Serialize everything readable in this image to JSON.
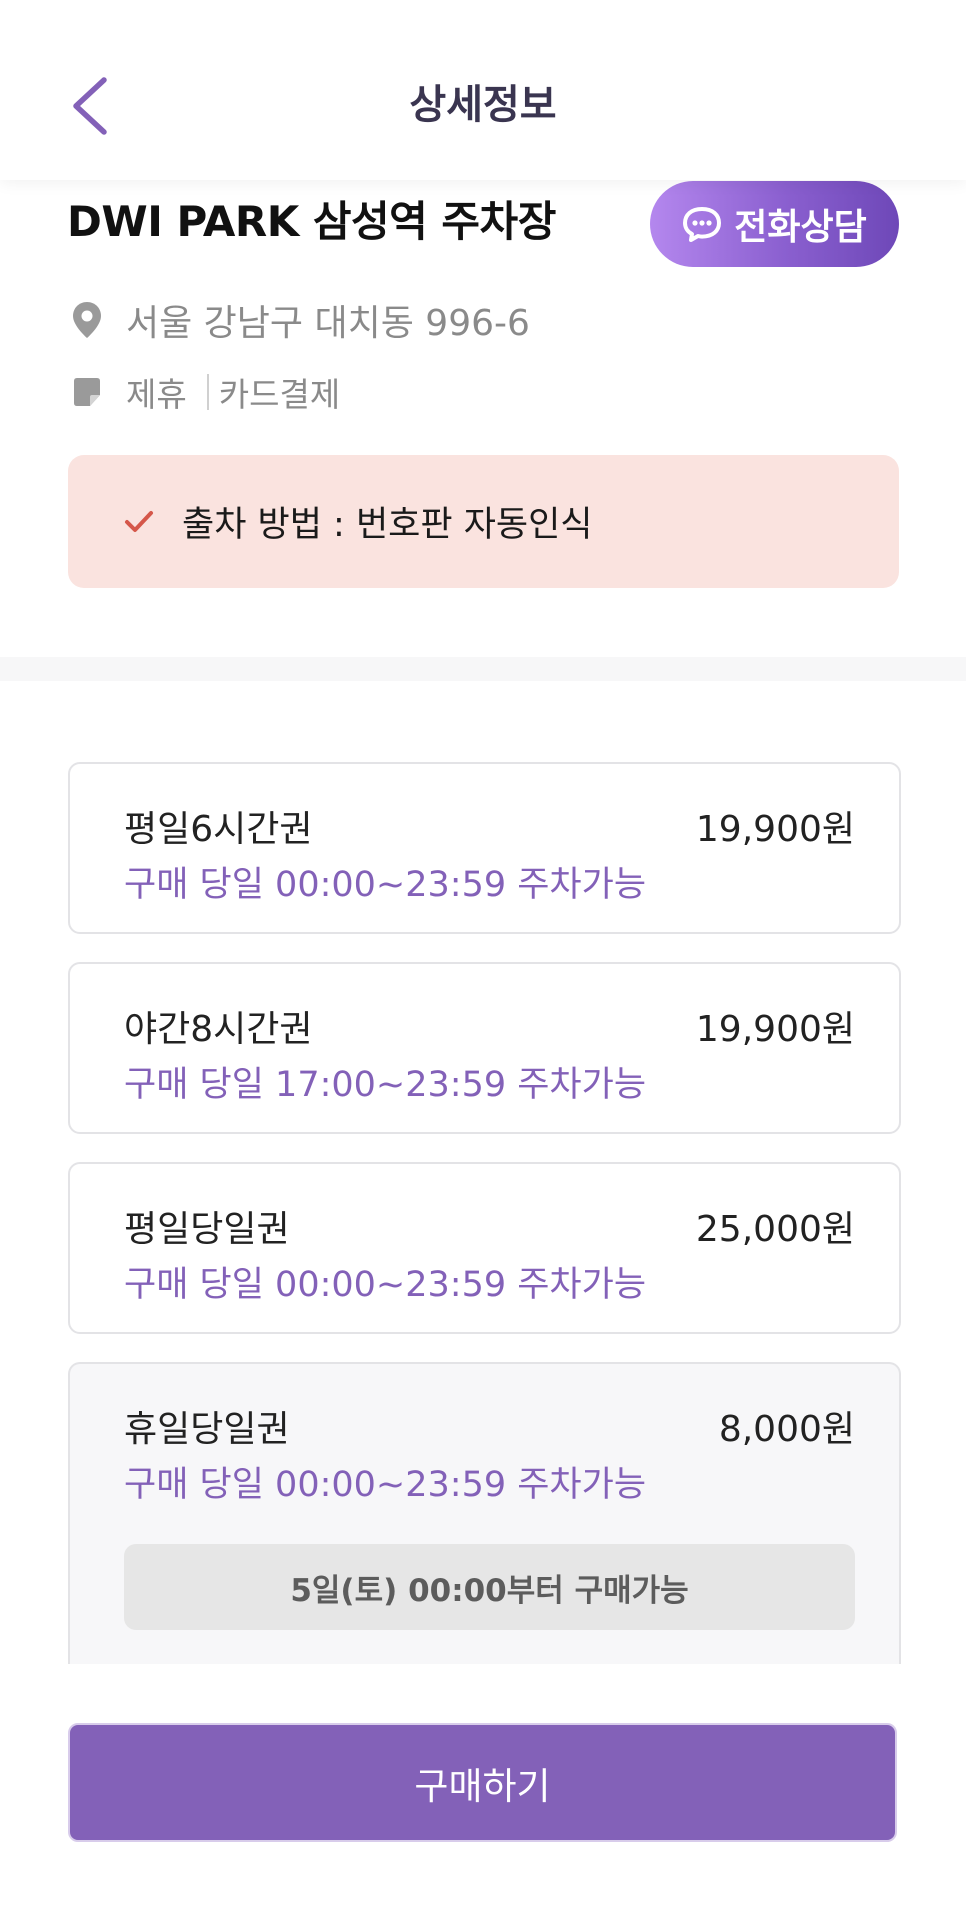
{
  "header": {
    "title": "상세정보",
    "back_icon": "chevron-left-icon"
  },
  "lot": {
    "name": "DWI PARK 삼성역 주차장",
    "call_button_label": "전화상담",
    "call_icon": "chat-bubble-icon",
    "address": "서울 강남구 대치동 996-6",
    "address_icon": "location-pin-icon",
    "tags": [
      "제휴",
      "카드결제"
    ],
    "tag_icon": "note-icon"
  },
  "notice": {
    "icon": "check-icon",
    "text": "출차 방법 : 번호판 자동인식"
  },
  "tickets": [
    {
      "name": "평일6시간권",
      "price": "19,900원",
      "description": "구매 당일 00:00~23:59 주차가능"
    },
    {
      "name": "야간8시간권",
      "price": "19,900원",
      "description": "구매 당일 17:00~23:59 주차가능"
    },
    {
      "name": "평일당일권",
      "price": "25,000원",
      "description": "구매 당일 00:00~23:59 주차가능"
    },
    {
      "name": "휴일당일권",
      "price": "8,000원",
      "description": "구매 당일 00:00~23:59 주차가능",
      "availability": "5일(토) 00:00부터 구매가능"
    }
  ],
  "purchase_button_label": "구매하기",
  "colors": {
    "accent": "#8361b8",
    "notice_bg": "#fae3df",
    "check": "#d5574a"
  }
}
